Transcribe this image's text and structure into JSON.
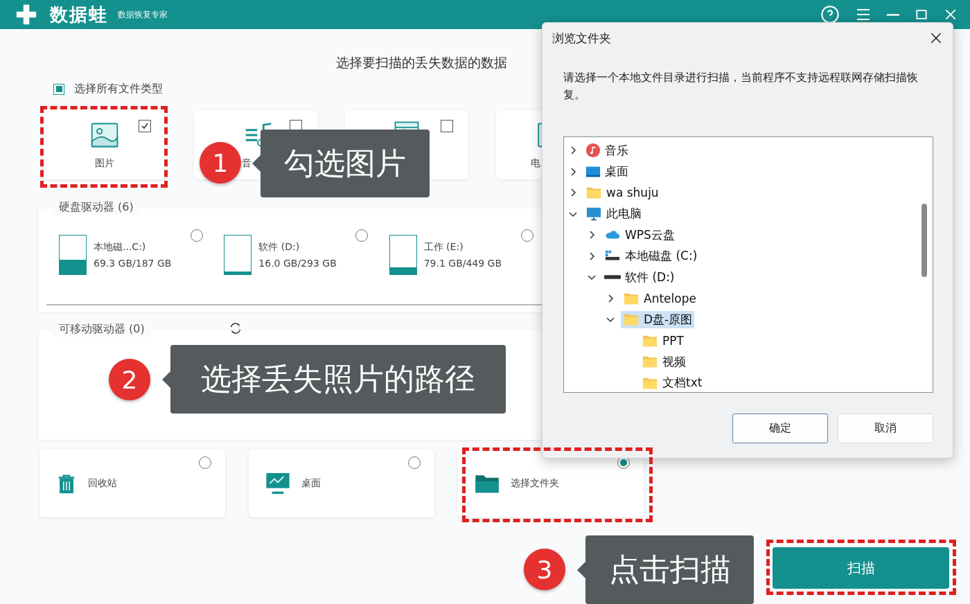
{
  "app": {
    "logo": "数据蛙",
    "subtitle": "数据恢复专家"
  },
  "title": "选择要扫描的丢失数据的数据",
  "select_all": {
    "label": "选择所有文件类型",
    "checked": true
  },
  "file_types": [
    {
      "kind": "image",
      "label": "图片",
      "checked": true
    },
    {
      "kind": "music",
      "label": "音",
      "checked": false
    },
    {
      "kind": "video",
      "checked": false
    },
    {
      "kind": "doc",
      "label": "电"
    }
  ],
  "disk_drives": {
    "title": "硬盘驱动器 (6)",
    "items": [
      {
        "name": "本地磁...C:)",
        "size": "69.3 GB/187 GB",
        "level": 0.37,
        "selected": false
      },
      {
        "name": "软件 (D:)",
        "size": "16.0 GB/293 GB",
        "level": 0.05,
        "selected": false
      },
      {
        "name": "工作 (E:)",
        "size": "79.1 GB/449 GB",
        "level": 0.18,
        "selected": false
      }
    ]
  },
  "removable_drives": {
    "title": "可移动驱动器 (0)"
  },
  "locations": [
    {
      "kind": "recycle",
      "label": "回收站",
      "selected": false
    },
    {
      "kind": "desktop",
      "label": "桌面",
      "selected": false
    },
    {
      "kind": "folder",
      "label": "选择文件夹",
      "selected": true
    }
  ],
  "scan_button": "扫描",
  "dialog": {
    "title": "浏览文件夹",
    "message": "请选择一个本地文件目录进行扫描，当前程序不支持远程联网存储扫描恢复。",
    "tree": [
      {
        "label": "音乐",
        "kind": "music",
        "expanded": false,
        "selected": false
      },
      {
        "label": "桌面",
        "kind": "desktop",
        "expanded": false,
        "selected": false
      },
      {
        "label": "wa shuju",
        "kind": "folder",
        "expanded": false,
        "selected": false
      },
      {
        "label": "此电脑",
        "kind": "pc",
        "expanded": true,
        "selected": false,
        "children": [
          {
            "label": "WPS云盘",
            "kind": "cloud",
            "expanded": false,
            "selected": false
          },
          {
            "label": "本地磁盘 (C:)",
            "kind": "sysdrive",
            "expanded": false,
            "selected": false
          },
          {
            "label": "软件 (D:)",
            "kind": "drive",
            "expanded": true,
            "selected": false,
            "children": [
              {
                "label": "Antelope",
                "kind": "folder",
                "expanded": false,
                "selected": false
              },
              {
                "label": "D盘-原图",
                "kind": "folder",
                "expanded": true,
                "selected": true,
                "children": [
                  {
                    "label": "PPT",
                    "kind": "folder",
                    "selected": false
                  },
                  {
                    "label": "视频",
                    "kind": "folder",
                    "selected": false
                  },
                  {
                    "label": "文档txt",
                    "kind": "folder",
                    "selected": false
                  }
                ]
              }
            ]
          }
        ]
      }
    ],
    "buttons": [
      "确定",
      "取消"
    ]
  },
  "annotations": [
    {
      "number": "1",
      "text": "勾选图片"
    },
    {
      "number": "2",
      "text": "选择丢失照片的路径"
    },
    {
      "number": "3",
      "text": "点击扫描"
    }
  ]
}
